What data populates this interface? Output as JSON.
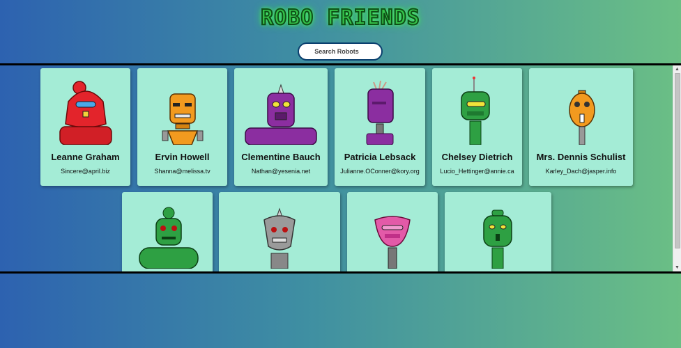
{
  "title": "ROBO FRIENDS",
  "search": {
    "placeholder": "Search Robots"
  },
  "robots": [
    {
      "name": "Leanne Graham",
      "email": "Sincere@april.biz",
      "color": "#e3242b"
    },
    {
      "name": "Ervin Howell",
      "email": "Shanna@melissa.tv",
      "color": "#f29a1f"
    },
    {
      "name": "Clementine Bauch",
      "email": "Nathan@yesenia.net",
      "color": "#8b2ea0"
    },
    {
      "name": "Patricia Lebsack",
      "email": "Julianne.OConner@kory.org",
      "color": "#8b2ea0"
    },
    {
      "name": "Chelsey Dietrich",
      "email": "Lucio_Hettinger@annie.ca",
      "color": "#2ea043"
    },
    {
      "name": "Mrs. Dennis Schulist",
      "email": "Karley_Dach@jasper.info",
      "color": "#f29a1f"
    },
    {
      "name": "",
      "email": "",
      "color": "#2ea043"
    },
    {
      "name": "",
      "email": "",
      "color": "#9a9a9a"
    },
    {
      "name": "",
      "email": "",
      "color": "#e35aa8"
    },
    {
      "name": "",
      "email": "",
      "color": "#2ea043"
    }
  ]
}
